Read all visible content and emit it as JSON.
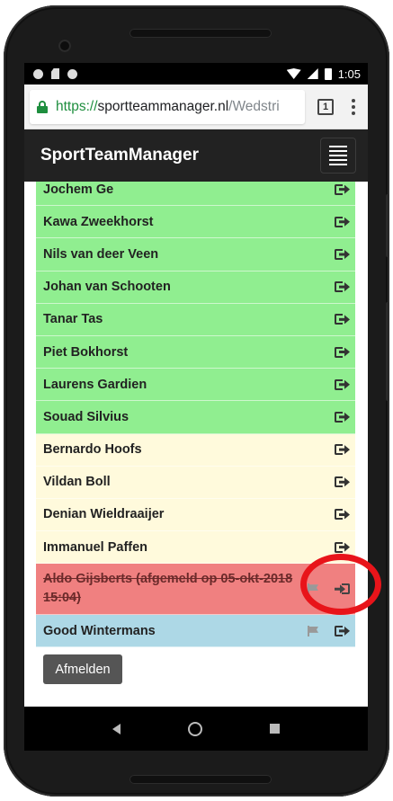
{
  "statusbar": {
    "time": "1:05"
  },
  "browser": {
    "url_scheme": "https://",
    "url_host": "sportteammanager.nl",
    "url_path": "/Wedstri",
    "tab_count": "1"
  },
  "navbar": {
    "brand": "SportTeamManager"
  },
  "colors": {
    "green": "#90ee90",
    "yellow": "#fffadc",
    "red": "#f08080",
    "blue": "#add8e6"
  },
  "players": [
    {
      "name": "Jochem Ge",
      "status": "green",
      "icon": "exit-icon"
    },
    {
      "name": "Kawa Zweekhorst",
      "status": "green",
      "icon": "exit-icon"
    },
    {
      "name": "Nils van deer Veen",
      "status": "green",
      "icon": "exit-icon"
    },
    {
      "name": "Johan van Schooten",
      "status": "green",
      "icon": "exit-icon"
    },
    {
      "name": "Tanar Tas",
      "status": "green",
      "icon": "exit-icon"
    },
    {
      "name": "Piet Bokhorst",
      "status": "green",
      "icon": "exit-icon"
    },
    {
      "name": "Laurens Gardien",
      "status": "green",
      "icon": "exit-icon"
    },
    {
      "name": "Souad Silvius",
      "status": "green",
      "icon": "exit-icon"
    },
    {
      "name": "Bernardo Hoofs",
      "status": "yellow",
      "icon": "exit-icon"
    },
    {
      "name": "Vildan Boll",
      "status": "yellow",
      "icon": "exit-icon"
    },
    {
      "name": "Denian Wieldraaijer",
      "status": "yellow",
      "icon": "exit-icon"
    },
    {
      "name": "Immanuel Paffen",
      "status": "yellow",
      "icon": "exit-icon"
    },
    {
      "name": "Aldo Gijsberts (afgemeld op 05-okt-2018 15:04)",
      "status": "red",
      "icon": "enter-icon",
      "flag": true,
      "strike": true
    },
    {
      "name": "Good Wintermans",
      "status": "blue",
      "icon": "exit-icon",
      "flag": true
    }
  ],
  "buttons": {
    "afmelden": "Afmelden"
  }
}
